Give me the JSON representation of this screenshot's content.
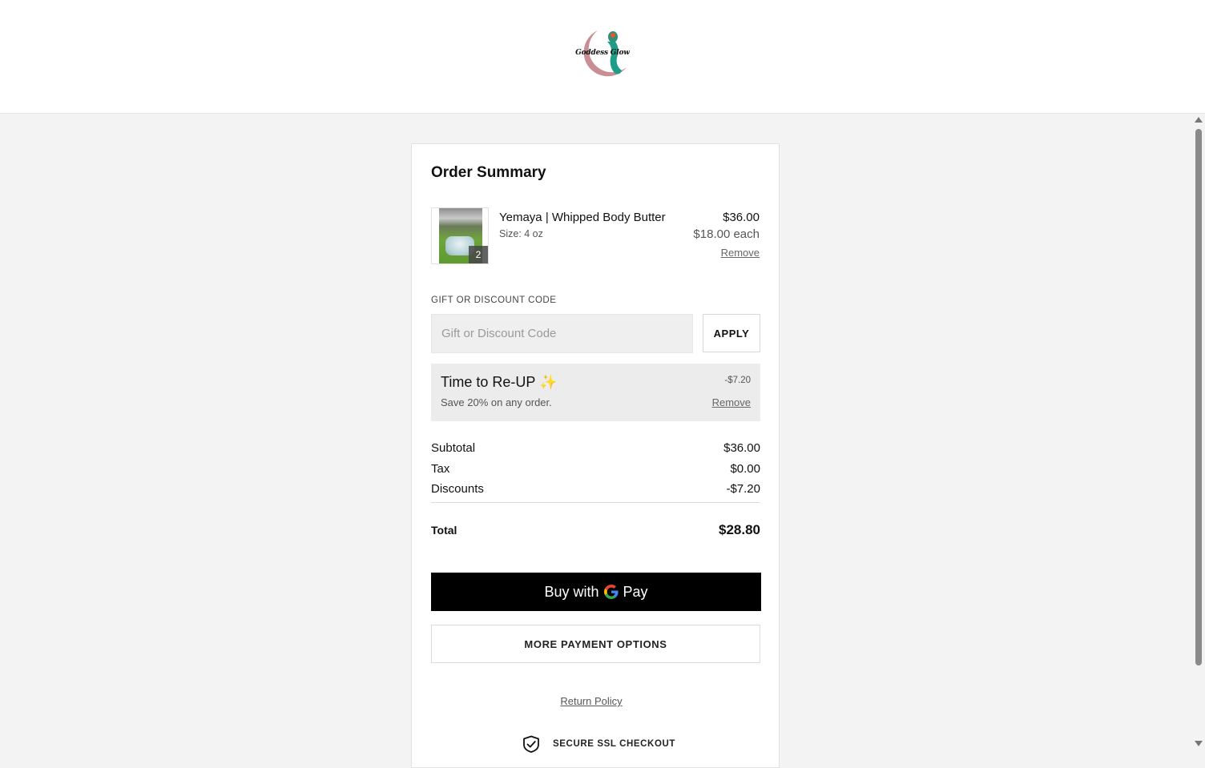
{
  "header": {
    "logo_text": "Goddess Glow"
  },
  "order_summary": {
    "title": "Order Summary",
    "item": {
      "name": "Yemaya | Whipped Body Butter",
      "variant": "Size: 4 oz",
      "quantity": "2",
      "price": "$36.00",
      "unit_price": "$18.00 each",
      "remove_label": "Remove"
    },
    "discount_code": {
      "label": "GIFT OR DISCOUNT CODE",
      "placeholder": "Gift or Discount Code",
      "value": "",
      "apply_label": "APPLY"
    },
    "promo": {
      "name": "Time to Re-UP ✨",
      "description": "Save 20% on any order.",
      "amount": "-$7.20",
      "remove_label": "Remove"
    },
    "totals": {
      "subtotal_label": "Subtotal",
      "subtotal": "$36.00",
      "tax_label": "Tax",
      "tax": "$0.00",
      "discounts_label": "Discounts",
      "discounts": "-$7.20",
      "total_label": "Total",
      "total": "$28.80"
    },
    "payment": {
      "gpay_prefix": "Buy with",
      "gpay_suffix": "Pay",
      "more_options_label": "MORE PAYMENT OPTIONS"
    },
    "footer": {
      "return_policy": "Return Policy",
      "secure_label": "SECURE SSL CHECKOUT"
    }
  },
  "colors": {
    "page_background": "#f3f3f3",
    "button_black": "#000000",
    "promo_background": "#ececec"
  },
  "icons": [
    "logo",
    "scroll-up-arrow",
    "scroll-down-arrow",
    "google-g-icon",
    "shield-check-icon"
  ]
}
